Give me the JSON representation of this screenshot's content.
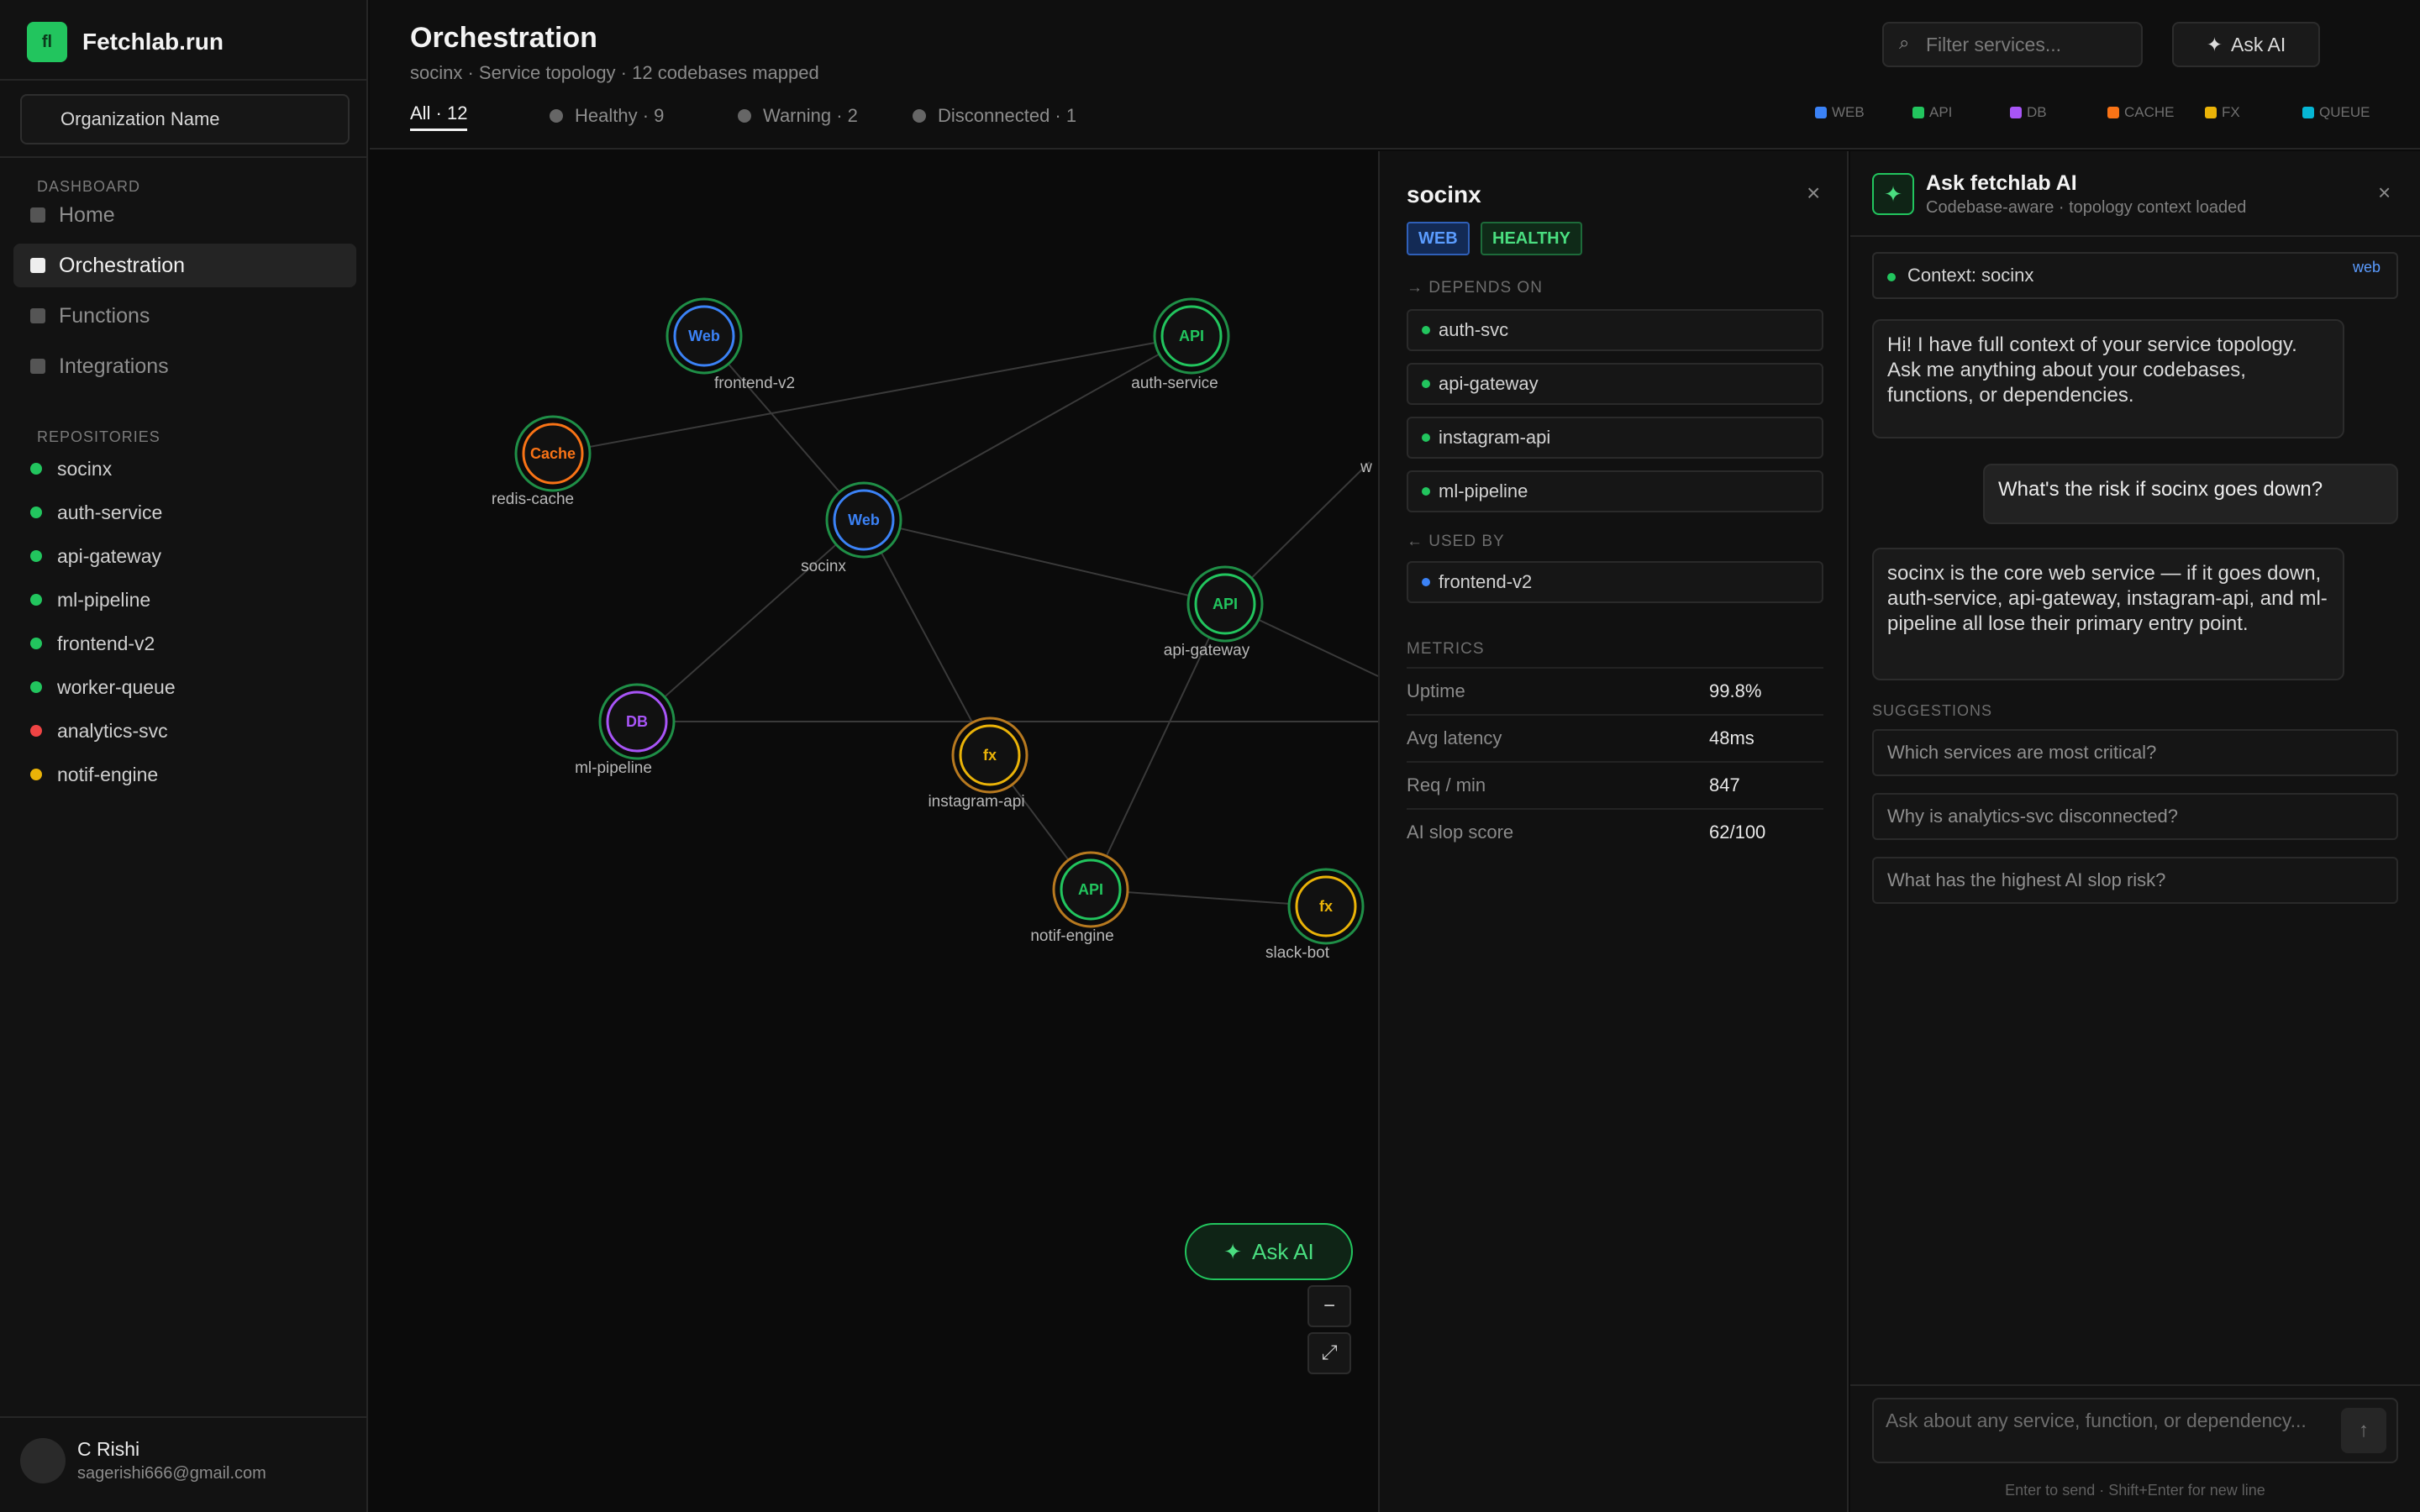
{
  "brand": {
    "logo": "fl",
    "name": "Fetchlab.run"
  },
  "sidebar": {
    "org_name": "Organization Name",
    "dashboard_section": "DASHBOARD",
    "nav": [
      {
        "label": "Home",
        "active": false
      },
      {
        "label": "Orchestration",
        "active": true
      },
      {
        "label": "Functions",
        "active": false
      },
      {
        "label": "Integrations",
        "active": false
      }
    ],
    "repositories_section": "REPOSITORIES",
    "repos": [
      {
        "name": "socinx",
        "status_color": "#22c55e"
      },
      {
        "name": "auth-service",
        "status_color": "#22c55e"
      },
      {
        "name": "api-gateway",
        "status_color": "#22c55e"
      },
      {
        "name": "ml-pipeline",
        "status_color": "#22c55e"
      },
      {
        "name": "frontend-v2",
        "status_color": "#22c55e"
      },
      {
        "name": "worker-queue",
        "status_color": "#22c55e"
      },
      {
        "name": "analytics-svc",
        "status_color": "#ef4444"
      },
      {
        "name": "notif-engine",
        "status_color": "#eab308"
      }
    ],
    "user": {
      "name": "C Rishi",
      "email": "sagerishi666@gmail.com"
    }
  },
  "header": {
    "title": "Orchestration",
    "subtitle": "socinx  ·  Service topology · 12 codebases mapped",
    "tabs": [
      {
        "label": "All · 12",
        "active": true
      },
      {
        "label": "Healthy · 9",
        "active": false
      },
      {
        "label": "Warning · 2",
        "active": false
      },
      {
        "label": "Disconnected · 1",
        "active": false
      }
    ],
    "filter_placeholder": "Filter services...",
    "ask_ai_label": "Ask AI",
    "legend": [
      {
        "label": "WEB",
        "color": "#3b82f6"
      },
      {
        "label": "API",
        "color": "#22c55e"
      },
      {
        "label": "DB",
        "color": "#a855f7"
      },
      {
        "label": "CACHE",
        "color": "#f97316"
      },
      {
        "label": "FX",
        "color": "#eab308"
      },
      {
        "label": "QUEUE",
        "color": "#06b6d4"
      }
    ]
  },
  "graph": {
    "nodes": [
      {
        "id": "frontend-v2",
        "label": "frontend-v2",
        "type": "Web",
        "color": "#3b82f6"
      },
      {
        "id": "auth-service",
        "label": "auth-service",
        "type": "API",
        "color": "#22c55e"
      },
      {
        "id": "redis-cache",
        "label": "redis-cache",
        "type": "Cache",
        "color": "#f97316"
      },
      {
        "id": "socinx",
        "label": "socinx",
        "type": "Web",
        "color": "#3b82f6"
      },
      {
        "id": "api-gateway",
        "label": "api-gateway",
        "type": "API",
        "color": "#22c55e"
      },
      {
        "id": "ml-pipeline",
        "label": "ml-pipeline",
        "type": "DB",
        "color": "#a855f7"
      },
      {
        "id": "instagram-api",
        "label": "instagram-api",
        "type": "fx",
        "color": "#eab308"
      },
      {
        "id": "notif-engine",
        "label": "notif-engine",
        "type": "API",
        "color": "#22c55e"
      },
      {
        "id": "slack-bot",
        "label": "slack-bot",
        "type": "fx",
        "color": "#eab308"
      },
      {
        "id": "worker-queue",
        "label": "w",
        "type": "",
        "color": "#22c55e"
      }
    ],
    "ask_ai_label": "Ask AI",
    "zoom_out_label": "−",
    "fit_label": "⤢"
  },
  "detail": {
    "title": "socinx",
    "badges": [
      "WEB",
      "HEALTHY"
    ],
    "depends_on_title": "→ DEPENDS ON",
    "depends_on": [
      {
        "name": "auth-svc",
        "color": "#22c55e"
      },
      {
        "name": "api-gateway",
        "color": "#22c55e"
      },
      {
        "name": "instagram-api",
        "color": "#22c55e"
      },
      {
        "name": "ml-pipeline",
        "color": "#22c55e"
      }
    ],
    "used_by_title": "← USED BY",
    "used_by": [
      {
        "name": "frontend-v2",
        "color": "#3b82f6"
      }
    ],
    "metrics_title": "METRICS",
    "metrics": [
      {
        "label": "Uptime",
        "value": "99.8%"
      },
      {
        "label": "Avg latency",
        "value": "48ms"
      },
      {
        "label": "Req / min",
        "value": "847"
      },
      {
        "label": "AI slop score",
        "value": "62/100"
      }
    ]
  },
  "ai": {
    "title": "Ask fetchlab AI",
    "subtitle": "Codebase-aware · topology context loaded",
    "context_label": "Context: socinx",
    "context_tag": "web",
    "messages": [
      {
        "role": "assistant",
        "text": "Hi! I have full context of your service topology. Ask me anything about your codebases, functions, or dependencies."
      },
      {
        "role": "user",
        "text": "What's the risk if socinx goes down?"
      },
      {
        "role": "assistant",
        "text": "socinx is the core web service — if it goes down, auth-service, api-gateway, instagram-api, and ml-pipeline all lose their primary entry point."
      }
    ],
    "suggestions_title": "SUGGESTIONS",
    "suggestions": [
      "Which services are most critical?",
      "Why is analytics-svc disconnected?",
      "What has the highest AI slop risk?"
    ],
    "input_placeholder": "Ask about any service, function, or dependency...",
    "send_label": "↑",
    "hint": "Enter to send · Shift+Enter for new line"
  }
}
